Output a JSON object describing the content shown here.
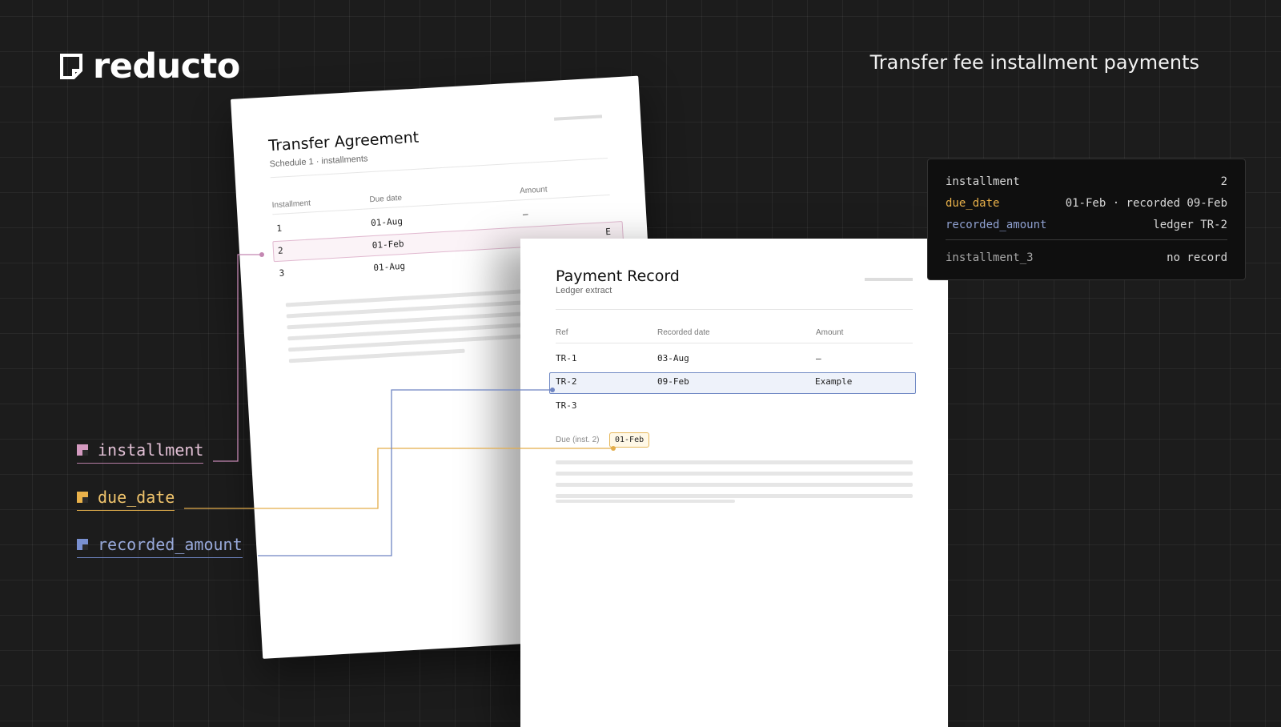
{
  "brand": {
    "name": "reducto"
  },
  "header": {
    "title": "Transfer fee installment payments"
  },
  "agreement": {
    "title": "Transfer Agreement",
    "subtitle": "Schedule 1 · installments",
    "columns": [
      "Installment",
      "Due date",
      "Amount"
    ],
    "rows": [
      {
        "installment": "1",
        "due": "01-Aug",
        "amount": "–"
      },
      {
        "installment": "2",
        "due": "01-Feb",
        "amount": "E"
      },
      {
        "installment": "3",
        "due": "01-Aug",
        "amount": "–"
      }
    ]
  },
  "payment_record": {
    "title": "Payment Record",
    "subtitle": "Ledger extract",
    "columns": [
      "Ref",
      "Recorded date",
      "Amount"
    ],
    "rows": [
      {
        "ref": "TR-1",
        "date": "03-Aug",
        "amount": "–"
      },
      {
        "ref": "TR-2",
        "date": "09-Feb",
        "amount": "Example"
      },
      {
        "ref": "TR-3",
        "date": "",
        "amount": ""
      }
    ],
    "due_label": "Due (inst. 2)",
    "due_value": "01-Feb"
  },
  "output": {
    "rows": [
      {
        "key": "installment",
        "value": "2",
        "color": "#d9d9d9"
      },
      {
        "key": "due_date",
        "value": "01-Feb · recorded 09-Feb",
        "color": "#e9b14a"
      },
      {
        "key": "recorded_amount",
        "value": "ledger TR-2",
        "color": "#8fa0d0"
      }
    ],
    "footer": {
      "key": "installment_3",
      "value": "no record"
    }
  },
  "fields": [
    {
      "label": "installment",
      "color": "#d49ac0"
    },
    {
      "label": "due_date",
      "color": "#e9b14a"
    },
    {
      "label": "recorded_amount",
      "color": "#7990d0"
    }
  ]
}
